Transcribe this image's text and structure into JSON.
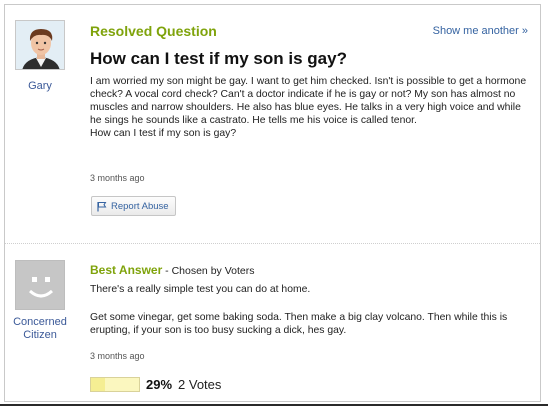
{
  "question": {
    "status": "Resolved Question",
    "show_another": "Show me another »",
    "title": "How can I test if my son is gay?",
    "body_lines": [
      "I am worried my son might be gay. I want to get him checked. Isn't is possible to get a hormone check? A vocal cord check? Can't a doctor indicate if he is gay or not? My son has almost no muscles and narrow shoulders. He also has blue eyes. He talks in a very high voice and while he sings he sounds like a castrato. He tells me his voice is called tenor.",
      "How can I test if my son is gay?"
    ],
    "time": "3 months ago",
    "report_abuse": "Report Abuse",
    "asker": {
      "name": "Gary",
      "avatar_icon": "user-avatar-icon"
    }
  },
  "answer": {
    "best_label": "Best Answer",
    "chosen_by": " - Chosen by Voters",
    "line1": "There's a really simple test you can do at home.",
    "line2": "Get some vinegar, get some baking soda. Then make a big clay volcano. Then while this is erupting, if your son is too busy sucking a dick, hes gay.",
    "time": "3 months ago",
    "answerer": {
      "name": "Concerned Citizen",
      "avatar_icon": "smiley-avatar-icon"
    },
    "vote_percent": "29%",
    "vote_fraction": 0.29,
    "votes": "2 Votes"
  },
  "colors": {
    "accent_green": "#7fa30b",
    "link_blue": "#3563a1",
    "vote_bar": "#fbf7bf"
  }
}
